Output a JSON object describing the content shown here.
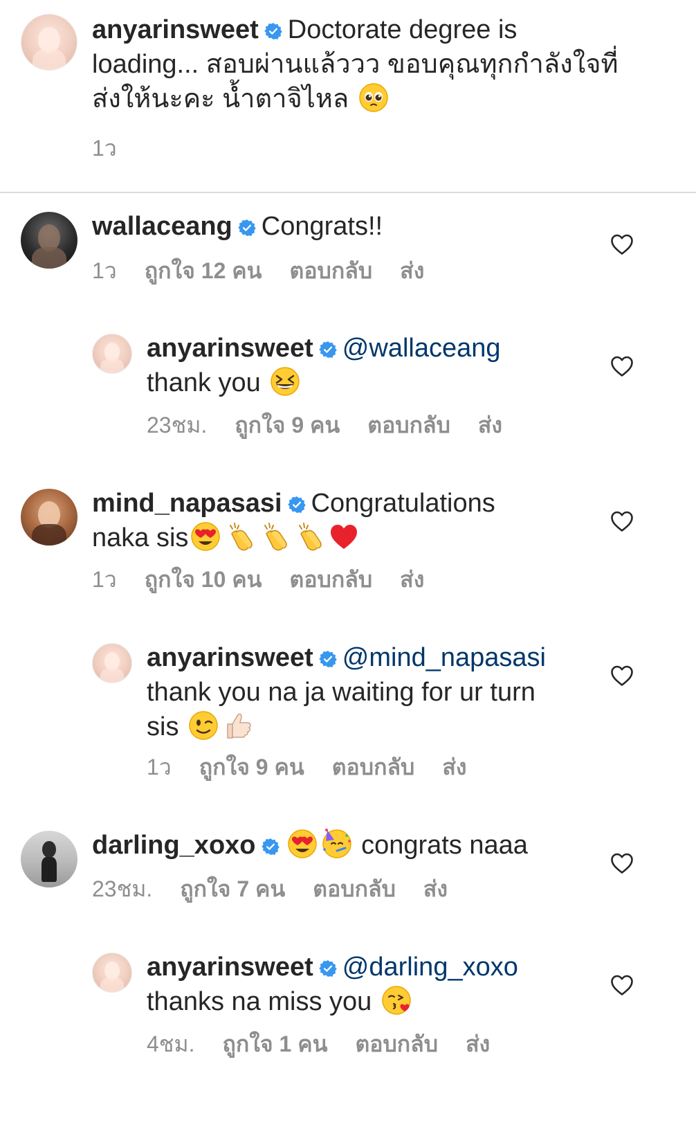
{
  "caption": {
    "username": "anyarinsweet",
    "text_line1": "Doctorate degree is",
    "text_line2": "loading... สอบผ่านแล้ววว ขอบคุณทุกกำลังใจที่",
    "text_line3": "ส่งให้นะคะ น้ำตาจิไหล",
    "time": "1ว"
  },
  "comments": [
    {
      "username": "wallaceang",
      "text": "Congrats!!",
      "time": "1ว",
      "likes": "ถูกใจ 12 คน",
      "reply": "ตอบกลับ",
      "send": "ส่ง"
    },
    {
      "username": "anyarinsweet",
      "mention": "@wallaceang",
      "text": "thank you",
      "time": "23ชม.",
      "likes": "ถูกใจ 9 คน",
      "reply": "ตอบกลับ",
      "send": "ส่ง"
    },
    {
      "username": "mind_napasasi",
      "text_line1": "Congratulations",
      "text_line2": "naka sis",
      "time": "1ว",
      "likes": "ถูกใจ 10 คน",
      "reply": "ตอบกลับ",
      "send": "ส่ง"
    },
    {
      "username": "anyarinsweet",
      "mention": "@mind_napasasi",
      "text_line1": "thank you na ja waiting for ur turn",
      "text_line2": "sis",
      "time": "1ว",
      "likes": "ถูกใจ 9 คน",
      "reply": "ตอบกลับ",
      "send": "ส่ง"
    },
    {
      "username": "darling_xoxo",
      "text": "congrats naaa",
      "time": "23ชม.",
      "likes": "ถูกใจ 7 คน",
      "reply": "ตอบกลับ",
      "send": "ส่ง"
    },
    {
      "username": "anyarinsweet",
      "mention": "@darling_xoxo",
      "text": "thanks na miss you",
      "time": "4ชม.",
      "likes": "ถูกใจ 1 คน",
      "reply": "ตอบกลับ",
      "send": "ส่ง"
    }
  ],
  "colors": {
    "verified": "#3897f0",
    "mention": "#00376b",
    "meta": "#8e8e8e",
    "text": "#262626",
    "divider": "#dbdbdb"
  },
  "icons": [
    "verified-badge-icon",
    "heart-icon",
    "pleading-face-emoji",
    "grinning-squinting-face-emoji",
    "heart-eyes-emoji",
    "clapping-hands-emoji",
    "red-heart-emoji",
    "winking-face-emoji",
    "thumbs-up-emoji",
    "partying-face-emoji",
    "face-blowing-kiss-emoji"
  ]
}
